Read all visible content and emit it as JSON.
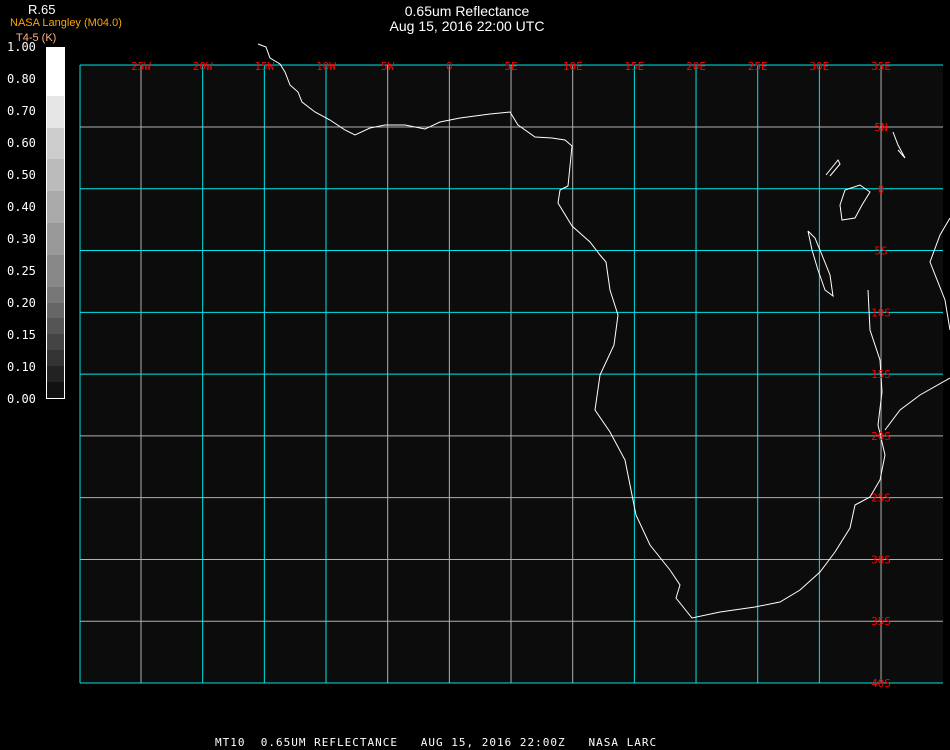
{
  "header": {
    "title": "0.65um Reflectance",
    "subtitle": "Aug 15, 2016 22:00 UTC"
  },
  "legend": {
    "organization": "NASA Langley (M04.0)",
    "variable": "R.65",
    "unit": "T4-5 (K)",
    "ticks": [
      "1.00",
      "0.80",
      "0.70",
      "0.60",
      "0.50",
      "0.40",
      "0.30",
      "0.25",
      "0.20",
      "0.15",
      "0.10",
      "0.00"
    ],
    "range": [
      0,
      1
    ]
  },
  "map": {
    "lon_labels": [
      "25W",
      "20W",
      "15W",
      "10W",
      "5W",
      "0",
      "5E",
      "10E",
      "15E",
      "20E",
      "25E",
      "30E",
      "35E"
    ],
    "lat_labels": [
      "5N",
      "0",
      "5S",
      "10S",
      "15S",
      "20S",
      "25S",
      "30S",
      "35S",
      "40S"
    ],
    "extent": {
      "lon": [
        -30,
        35
      ],
      "lat": [
        10,
        -40
      ]
    },
    "colors": {
      "grid_primary": "#00e5e5",
      "grid_secondary": "#b0b0b0",
      "label": "#ff0000",
      "coastline": "#ffffff",
      "background": "#0c0c0c"
    }
  },
  "footer": {
    "text": "MT10  0.65UM REFLECTANCE   AUG 15, 2016 22:00Z   NASA LARC"
  }
}
